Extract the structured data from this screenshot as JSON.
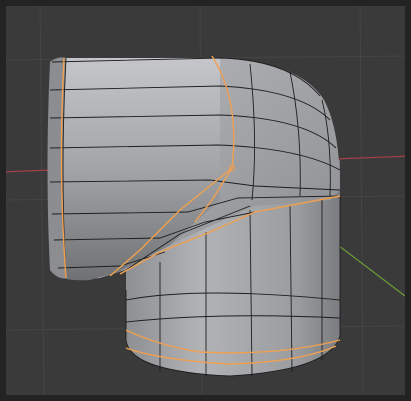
{
  "viewport": {
    "background": "#3a3a3a",
    "frame_color": "#232323",
    "grid_color": "#4a4a4a",
    "x_axis_color": "#a34048",
    "y_axis_color": "#6e9a3a"
  },
  "mesh": {
    "surface_color": "#a7a9ac",
    "edge_color": "#1e1e1e",
    "selected_edge_color": "#f0a050",
    "origin_color": "#f0a050"
  }
}
